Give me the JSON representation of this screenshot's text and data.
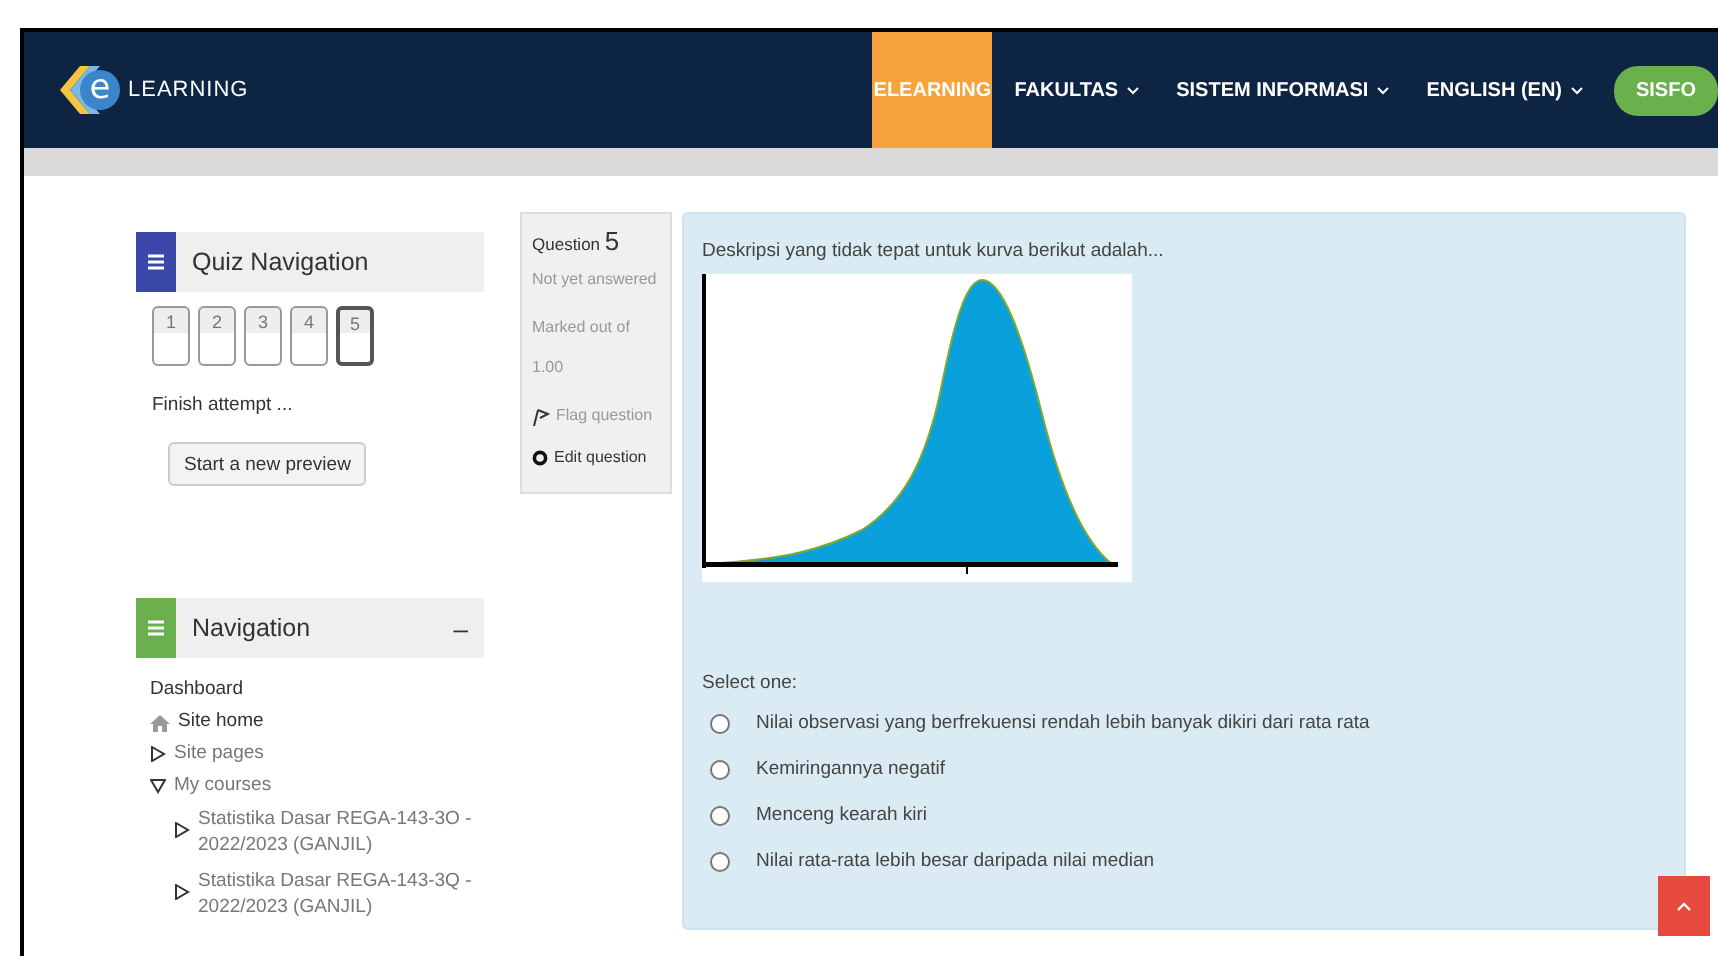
{
  "header": {
    "logo": {
      "mark": "e",
      "text": "LEARNING"
    },
    "menu": [
      {
        "label": "ELEARNING",
        "selected": true,
        "dropdown": false
      },
      {
        "label": "FAKULTAS",
        "selected": false,
        "dropdown": true
      },
      {
        "label": "SISTEM INFORMASI",
        "selected": false,
        "dropdown": true
      },
      {
        "label": "ENGLISH (EN)",
        "selected": false,
        "dropdown": true
      }
    ],
    "button": "SISFO"
  },
  "quiz_navigation": {
    "title": "Quiz Navigation",
    "questions": [
      {
        "label": "1",
        "selected": false
      },
      {
        "label": "2",
        "selected": false
      },
      {
        "label": "3",
        "selected": false
      },
      {
        "label": "4",
        "selected": false
      },
      {
        "label": "5",
        "selected": true
      }
    ],
    "finish": "Finish attempt ...",
    "preview_button": "Start a new preview"
  },
  "navigation": {
    "title": "Navigation",
    "collapse": "–",
    "items": [
      {
        "label": "Dashboard",
        "kind": "link"
      },
      {
        "label": "Site home",
        "kind": "home"
      },
      {
        "label": "Site pages",
        "kind": "branch",
        "expanded": false
      },
      {
        "label": "My courses",
        "kind": "branch",
        "expanded": true,
        "children": [
          {
            "label": "Statistika Dasar REGA-143-3O - 2022/2023 (GANJIL)",
            "kind": "branch",
            "expanded": false
          },
          {
            "label": "Statistika Dasar REGA-143-3Q - 2022/2023 (GANJIL)",
            "kind": "branch",
            "expanded": false
          }
        ]
      }
    ]
  },
  "question_info": {
    "label": "Question",
    "number": "5",
    "status": "Not yet answered",
    "marked": "Marked out of",
    "mark": "1.00",
    "flag": "Flag question",
    "edit": "Edit question"
  },
  "question": {
    "text": "Deskripsi yang tidak tepat untuk kurva berikut adalah...",
    "prompt": "Select one:",
    "options": [
      {
        "label": "Nilai observasi yang berfrekuensi rendah lebih banyak dikiri dari rata rata",
        "selected": false
      },
      {
        "label": "Kemiringannya negatif",
        "selected": false
      },
      {
        "label": "Menceng kearah kiri",
        "selected": false
      },
      {
        "label": "Nilai rata-rata lebih besar daripada nilai median",
        "selected": false
      }
    ]
  }
}
